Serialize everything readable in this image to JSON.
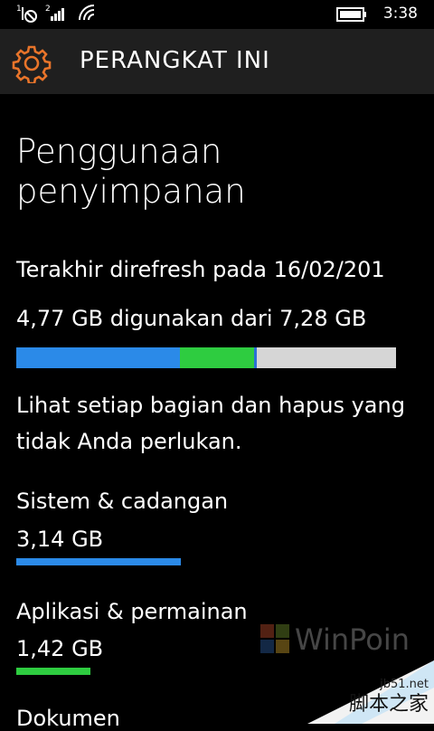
{
  "status": {
    "sim1": "1",
    "sim2": "2",
    "time": "3:38"
  },
  "header": {
    "title": "PERANGKAT INI"
  },
  "page": {
    "title": "Penggunaan penyimpanan",
    "refreshed": "Terakhir direfresh pada 16/02/201",
    "used": "4,77 GB digunakan dari 7,28 GB",
    "hint": "Lihat setiap bagian dan hapus yang tidak Anda perlukan."
  },
  "storage": {
    "used_gb": 4.77,
    "total_gb": 7.28,
    "segments": [
      {
        "name": "Sistem & cadangan",
        "gb": 3.14,
        "color": "#2b8ae8"
      },
      {
        "name": "Aplikasi & permainan",
        "gb": 1.42,
        "color": "#2ecc40"
      },
      {
        "name": "Dokumen",
        "gb": 0.06,
        "color": "#2b6fd6"
      }
    ]
  },
  "categories": [
    {
      "name": "Sistem & cadangan",
      "size": "3,14 GB",
      "color": "#2b8ae8"
    },
    {
      "name": "Aplikasi & permainan",
      "size": "1,42 GB",
      "color": "#2ecc40"
    },
    {
      "name": "Dokumen",
      "size": ""
    }
  ],
  "watermark": {
    "brand": "WinPoin",
    "site": "jb51.net",
    "site_cn": "脚本之家"
  },
  "colors": {
    "accent": "#e8742a",
    "bar_bg": "#d6d6d6",
    "header_bg": "#1f1f1f"
  }
}
